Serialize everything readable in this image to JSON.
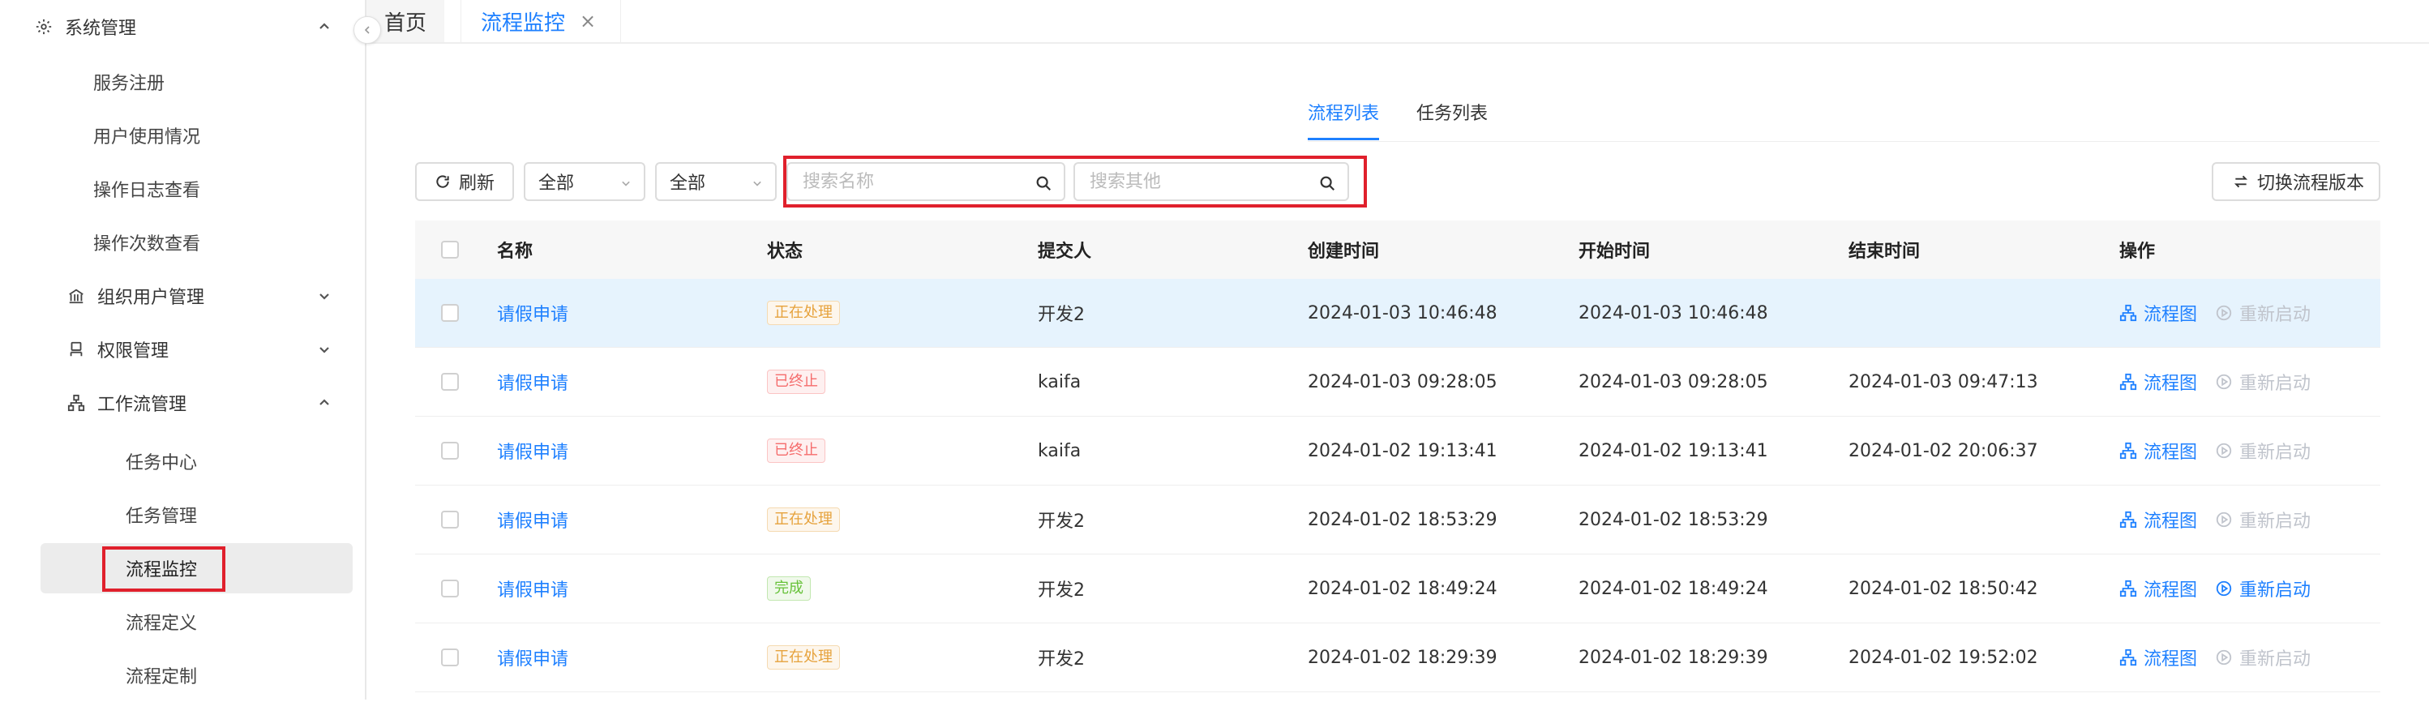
{
  "sidebar": {
    "group_system": "系统管理",
    "system_items": [
      "服务注册",
      "用户使用情况",
      "操作日志查看",
      "操作次数查看"
    ],
    "group_org": "组织用户管理",
    "group_perm": "权限管理",
    "group_workflow": "工作流管理",
    "workflow_items": [
      "任务中心",
      "任务管理",
      "流程监控",
      "流程定义",
      "流程定制"
    ]
  },
  "tabs": {
    "home": "首页",
    "active": "流程监控",
    "close": "×"
  },
  "subtabs": [
    "流程列表",
    "任务列表"
  ],
  "toolbar": {
    "refresh": "刷新",
    "select1": "全部",
    "select2": "全部",
    "search_name_placeholder": "搜索名称",
    "search_other_placeholder": "搜索其他",
    "switch_version": "切换流程版本"
  },
  "table": {
    "headers": [
      "名称",
      "状态",
      "提交人",
      "创建时间",
      "开始时间",
      "结束时间",
      "操作"
    ],
    "action_diagram": "流程图",
    "action_restart": "重新启动",
    "rows": [
      {
        "name": "请假申请",
        "status": "正在处理",
        "status_type": "processing",
        "submitter": "开发2",
        "created": "2024-01-03 10:46:48",
        "started": "2024-01-03 10:46:48",
        "ended": "",
        "restart_enabled": false
      },
      {
        "name": "请假申请",
        "status": "已终止",
        "status_type": "terminated",
        "submitter": "kaifa",
        "created": "2024-01-03 09:28:05",
        "started": "2024-01-03 09:28:05",
        "ended": "2024-01-03 09:47:13",
        "restart_enabled": false
      },
      {
        "name": "请假申请",
        "status": "已终止",
        "status_type": "terminated",
        "submitter": "kaifa",
        "created": "2024-01-02 19:13:41",
        "started": "2024-01-02 19:13:41",
        "ended": "2024-01-02 20:06:37",
        "restart_enabled": false
      },
      {
        "name": "请假申请",
        "status": "正在处理",
        "status_type": "processing",
        "submitter": "开发2",
        "created": "2024-01-02 18:53:29",
        "started": "2024-01-02 18:53:29",
        "ended": "",
        "restart_enabled": false
      },
      {
        "name": "请假申请",
        "status": "完成",
        "status_type": "done",
        "submitter": "开发2",
        "created": "2024-01-02 18:49:24",
        "started": "2024-01-02 18:49:24",
        "ended": "2024-01-02 18:50:42",
        "restart_enabled": true
      },
      {
        "name": "请假申请",
        "status": "正在处理",
        "status_type": "processing",
        "submitter": "开发2",
        "created": "2024-01-02 18:29:39",
        "started": "2024-01-02 18:29:39",
        "ended": "2024-01-02 19:52:02",
        "restart_enabled": false
      }
    ]
  },
  "colors": {
    "accent": "#1e80ff",
    "highlight": "#e0202c",
    "row_selected": "#e6f3fd"
  }
}
